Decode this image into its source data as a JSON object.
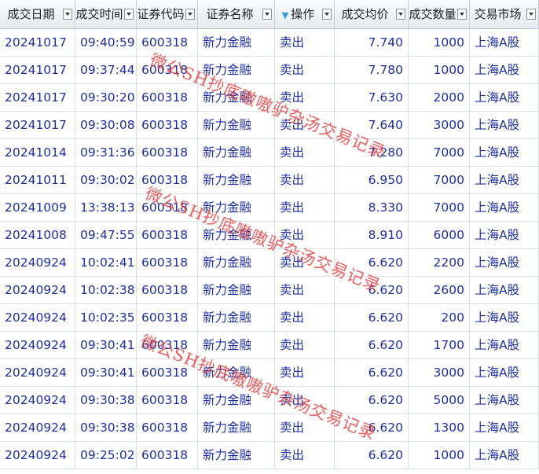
{
  "columns": [
    {
      "label": "成交日期",
      "align": "left"
    },
    {
      "label": "成交时间",
      "align": "left"
    },
    {
      "label": "证券代码",
      "align": "left"
    },
    {
      "label": "证券名称",
      "align": "left"
    },
    {
      "label": "操作",
      "align": "left",
      "sorted": true
    },
    {
      "label": "成交均价",
      "align": "right"
    },
    {
      "label": "成交数量",
      "align": "right"
    },
    {
      "label": "交易市场",
      "align": "left"
    }
  ],
  "rows": [
    [
      "20241017",
      "09:40:59",
      "600318",
      "新力金融",
      "卖出",
      "7.740",
      "1000",
      "上海A股"
    ],
    [
      "20241017",
      "09:37:44",
      "600318",
      "新力金融",
      "卖出",
      "7.780",
      "1000",
      "上海A股"
    ],
    [
      "20241017",
      "09:30:20",
      "600318",
      "新力金融",
      "卖出",
      "7.630",
      "2000",
      "上海A股"
    ],
    [
      "20241017",
      "09:30:08",
      "600318",
      "新力金融",
      "卖出",
      "7.640",
      "3000",
      "上海A股"
    ],
    [
      "20241014",
      "09:31:36",
      "600318",
      "新力金融",
      "卖出",
      "7.280",
      "7000",
      "上海A股"
    ],
    [
      "20241011",
      "09:30:02",
      "600318",
      "新力金融",
      "卖出",
      "6.950",
      "7000",
      "上海A股"
    ],
    [
      "20241009",
      "13:38:13",
      "600318",
      "新力金融",
      "卖出",
      "8.330",
      "7000",
      "上海A股"
    ],
    [
      "20241008",
      "09:47:55",
      "600318",
      "新力金融",
      "卖出",
      "8.910",
      "6000",
      "上海A股"
    ],
    [
      "20240924",
      "10:02:41",
      "600318",
      "新力金融",
      "卖出",
      "6.620",
      "2200",
      "上海A股"
    ],
    [
      "20240924",
      "10:02:38",
      "600318",
      "新力金融",
      "卖出",
      "6.620",
      "2600",
      "上海A股"
    ],
    [
      "20240924",
      "10:02:35",
      "600318",
      "新力金融",
      "卖出",
      "6.620",
      "200",
      "上海A股"
    ],
    [
      "20240924",
      "09:30:41",
      "600318",
      "新力金融",
      "卖出",
      "6.620",
      "1700",
      "上海A股"
    ],
    [
      "20240924",
      "09:30:41",
      "600318",
      "新力金融",
      "卖出",
      "6.620",
      "3000",
      "上海A股"
    ],
    [
      "20240924",
      "09:30:38",
      "600318",
      "新力金融",
      "卖出",
      "6.620",
      "5000",
      "上海A股"
    ],
    [
      "20240924",
      "09:30:38",
      "600318",
      "新力金融",
      "卖出",
      "6.620",
      "1300",
      "上海A股"
    ],
    [
      "20240924",
      "09:25:02",
      "600318",
      "新力金融",
      "卖出",
      "6.620",
      "1000",
      "上海A股"
    ]
  ],
  "watermarks": [
    "微公SH抄底嗷嗷驴杂汤交易记录",
    "微公SH抄底嗷嗷驴杂汤交易记录",
    "微公SH抄底嗷嗷驴杂汤交易记录"
  ],
  "icons": {
    "sort": "sort-descending-icon",
    "filter": "dropdown-filter-icon"
  },
  "colors": {
    "cell_text": "#1c2fa0",
    "header_text": "#222222",
    "sort_indicator": "#2e9fd6",
    "watermark": "#e83a3a",
    "grid_line": "#d9dee3"
  }
}
